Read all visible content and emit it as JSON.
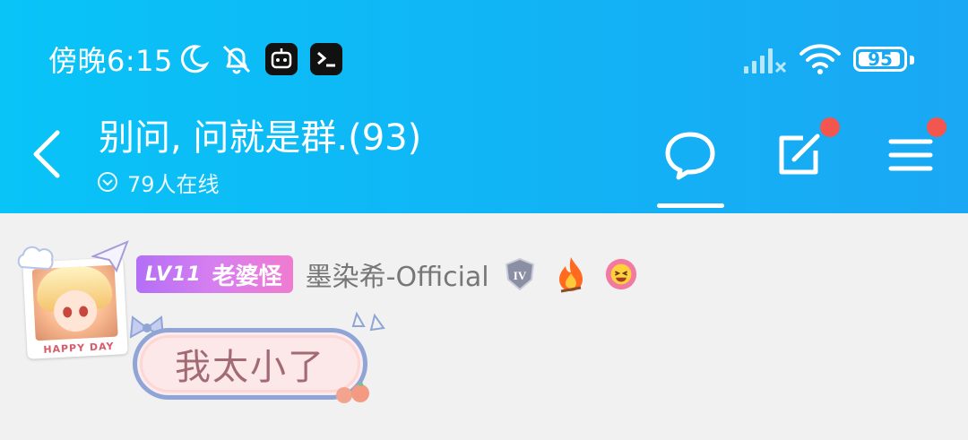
{
  "status_bar": {
    "time": "傍晚6:15",
    "battery": "95",
    "battery_level": 0.95
  },
  "header": {
    "title": "别问, 问就是群.(93)",
    "online": "79人在线"
  },
  "message": {
    "level_badge": "LV11",
    "title_tag": "老婆怪",
    "nickname": "墨染希-Official",
    "frame_text": "HAPPY DAY",
    "text": "我太小了"
  },
  "colors": {
    "header_bg": "#12b2f5",
    "notify_dot": "#f3564f",
    "bubble_border": "#8fa5d6",
    "bubble_text": "#a26a73"
  }
}
